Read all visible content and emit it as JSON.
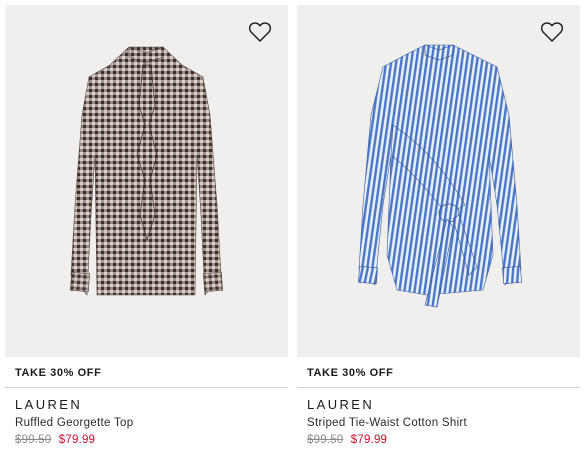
{
  "products": [
    {
      "promo": "TAKE 30% OFF",
      "brand": "LAUREN",
      "name": "Ruffled Georgette Top",
      "original_price": "$99.50",
      "sale_price": "$79.99",
      "wishlist_icon": "heart-outline-icon"
    },
    {
      "promo": "TAKE 30% OFF",
      "brand": "LAUREN",
      "name": "Striped Tie-Waist Cotton Shirt",
      "original_price": "$99.50",
      "sale_price": "$79.99",
      "wishlist_icon": "heart-outline-icon"
    }
  ],
  "colors": {
    "image_bg": "#f0efee",
    "sale_price": "#c8102e",
    "original_price": "#8a8a8a",
    "divider": "#cfcfcf"
  }
}
